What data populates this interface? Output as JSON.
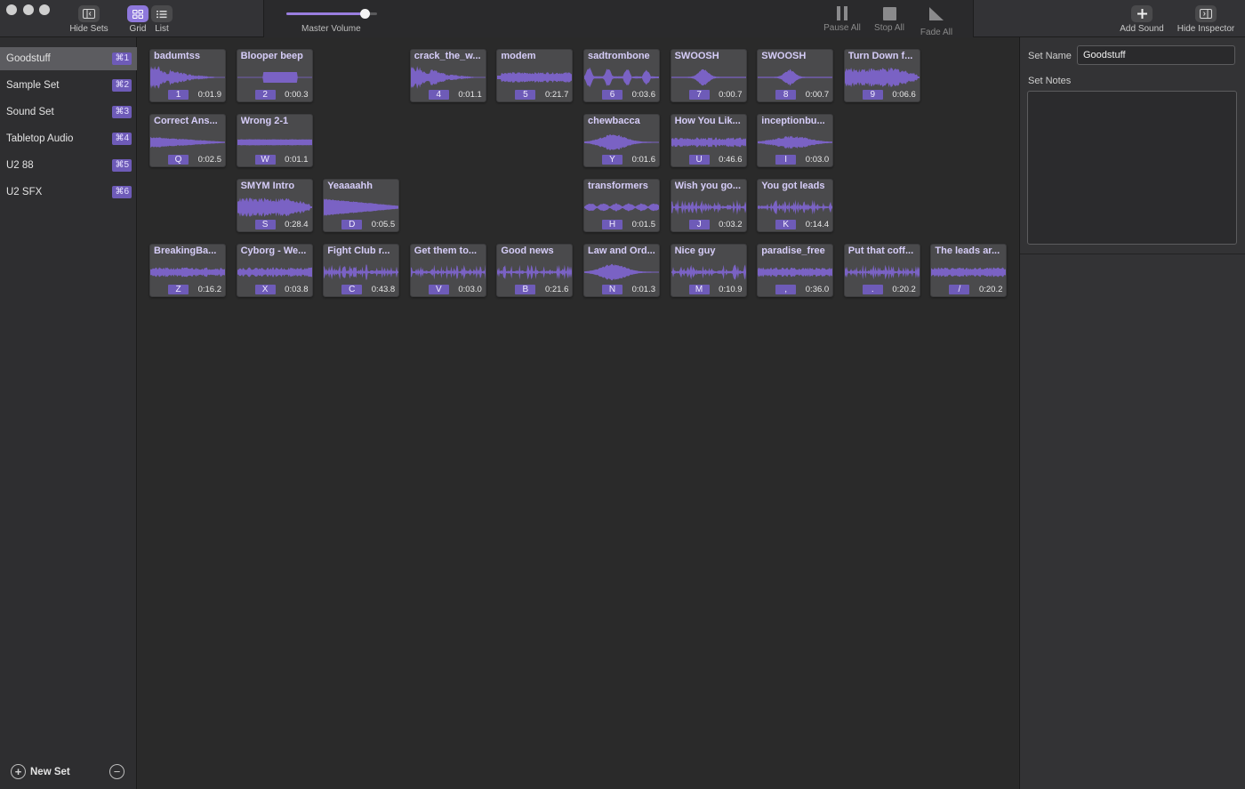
{
  "window": {
    "traffic_lights": [
      "close",
      "minimize",
      "zoom"
    ]
  },
  "toolbar": {
    "hide_sets": "Hide Sets",
    "grid": "Grid",
    "list": "List",
    "master_volume": "Master Volume",
    "master_volume_level": 0.86,
    "pause_all": "Pause All",
    "stop_all": "Stop All",
    "fade_all": "Fade All",
    "add_sound": "Add Sound",
    "hide_inspector": "Hide Inspector"
  },
  "sidebar": {
    "sets": [
      {
        "name": "Goodstuff",
        "shortcut": "⌘1",
        "selected": true
      },
      {
        "name": "Sample Set",
        "shortcut": "⌘2"
      },
      {
        "name": "Sound Set",
        "shortcut": "⌘3"
      },
      {
        "name": "Tabletop Audio",
        "shortcut": "⌘4"
      },
      {
        "name": "U2 88",
        "shortcut": "⌘5"
      },
      {
        "name": "U2 SFX",
        "shortcut": "⌘6"
      }
    ],
    "new_set": "New Set"
  },
  "sounds": [
    {
      "name": "badumtss",
      "key": "1",
      "duration": "0:01.9",
      "row": 0,
      "col": 0,
      "wave": "burst"
    },
    {
      "name": "Blooper beep",
      "key": "2",
      "duration": "0:00.3",
      "row": 0,
      "col": 1,
      "wave": "block"
    },
    {
      "name": "crack_the_w...",
      "key": "4",
      "duration": "0:01.1",
      "row": 0,
      "col": 3,
      "wave": "burst"
    },
    {
      "name": "modem",
      "key": "5",
      "duration": "0:21.7",
      "row": 0,
      "col": 4,
      "wave": "dense"
    },
    {
      "name": "sadtrombone",
      "key": "6",
      "duration": "0:03.6",
      "row": 0,
      "col": 5,
      "wave": "pulses"
    },
    {
      "name": "SWOOSH",
      "key": "7",
      "duration": "0:00.7",
      "row": 0,
      "col": 6,
      "wave": "swoosh"
    },
    {
      "name": "SWOOSH",
      "key": "8",
      "duration": "0:00.7",
      "row": 0,
      "col": 7,
      "wave": "swoosh"
    },
    {
      "name": "Turn Down f...",
      "key": "9",
      "duration": "0:06.6",
      "row": 0,
      "col": 8,
      "wave": "loud"
    },
    {
      "name": "Correct Ans...",
      "key": "Q",
      "duration": "0:02.5",
      "row": 1,
      "col": 0,
      "wave": "fade"
    },
    {
      "name": "Wrong 2-1",
      "key": "W",
      "duration": "0:01.1",
      "row": 1,
      "col": 1,
      "wave": "flat"
    },
    {
      "name": "chewbacca",
      "key": "Y",
      "duration": "0:01.6",
      "row": 1,
      "col": 5,
      "wave": "blob"
    },
    {
      "name": "How You Lik...",
      "key": "U",
      "duration": "0:46.6",
      "row": 1,
      "col": 6,
      "wave": "music"
    },
    {
      "name": "inceptionbu...",
      "key": "I",
      "duration": "0:03.0",
      "row": 1,
      "col": 7,
      "wave": "swell"
    },
    {
      "name": "SMYM Intro",
      "key": "S",
      "duration": "0:28.4",
      "row": 2,
      "col": 1,
      "wave": "loud"
    },
    {
      "name": "Yeaaaahh",
      "key": "D",
      "duration": "0:05.5",
      "row": 2,
      "col": 2,
      "wave": "wedge"
    },
    {
      "name": "transformers",
      "key": "H",
      "duration": "0:01.5",
      "row": 2,
      "col": 5,
      "wave": "beads"
    },
    {
      "name": "Wish you go...",
      "key": "J",
      "duration": "0:03.2",
      "row": 2,
      "col": 6,
      "wave": "speech"
    },
    {
      "name": "You got leads",
      "key": "K",
      "duration": "0:14.4",
      "row": 2,
      "col": 7,
      "wave": "speech"
    },
    {
      "name": "BreakingBa...",
      "key": "Z",
      "duration": "0:16.2",
      "row": 3,
      "col": 0,
      "wave": "music"
    },
    {
      "name": "Cyborg - We...",
      "key": "X",
      "duration": "0:03.8",
      "row": 3,
      "col": 1,
      "wave": "music"
    },
    {
      "name": "Fight Club r...",
      "key": "C",
      "duration": "0:43.8",
      "row": 3,
      "col": 2,
      "wave": "speech"
    },
    {
      "name": "Get them to...",
      "key": "V",
      "duration": "0:03.0",
      "row": 3,
      "col": 3,
      "wave": "speech"
    },
    {
      "name": "Good news",
      "key": "B",
      "duration": "0:21.6",
      "row": 3,
      "col": 4,
      "wave": "speech"
    },
    {
      "name": "Law and Ord...",
      "key": "N",
      "duration": "0:01.3",
      "row": 3,
      "col": 5,
      "wave": "blob"
    },
    {
      "name": "Nice guy",
      "key": "M",
      "duration": "0:10.9",
      "row": 3,
      "col": 6,
      "wave": "speech"
    },
    {
      "name": "paradise_free",
      "key": ",",
      "duration": "0:36.0",
      "row": 3,
      "col": 7,
      "wave": "music"
    },
    {
      "name": "Put that coff...",
      "key": ".",
      "duration": "0:20.2",
      "row": 3,
      "col": 8,
      "wave": "speech"
    },
    {
      "name": "The leads ar...",
      "key": "/",
      "duration": "0:20.2",
      "row": 3,
      "col": 9,
      "wave": "music"
    }
  ],
  "inspector": {
    "set_name_label": "Set Name",
    "set_name_value": "Goodstuff",
    "set_notes_label": "Set Notes",
    "set_notes_value": ""
  },
  "colors": {
    "accent": "#6e5bb8",
    "waveform": "#7a62c4",
    "tile_title": "#d6cdf8"
  }
}
